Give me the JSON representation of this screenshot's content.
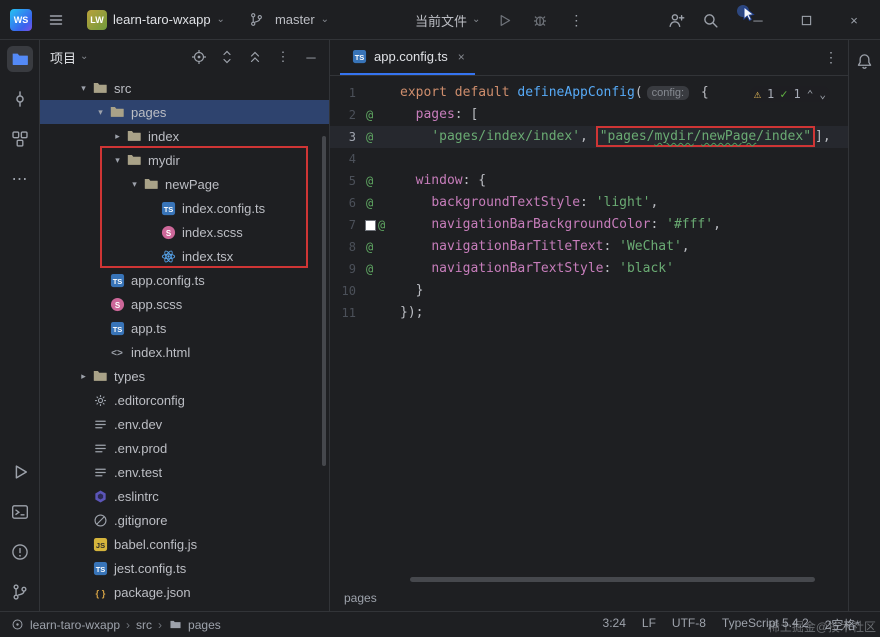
{
  "titlebar": {
    "logo": "WS",
    "project_avatar": "LW",
    "project_name": "learn-taro-wxapp",
    "branch": "master",
    "run_config": "当前文件"
  },
  "project_panel": {
    "title": "项目"
  },
  "tree": {
    "items": [
      {
        "label": "src",
        "type": "folder",
        "level": 1,
        "chev": "open"
      },
      {
        "label": "pages",
        "type": "folder",
        "level": 2,
        "chev": "open",
        "sel": 1
      },
      {
        "label": "index",
        "type": "folder",
        "level": 3,
        "chev": "closed"
      },
      {
        "label": "mydir",
        "type": "folder",
        "level": 3,
        "chev": "open"
      },
      {
        "label": "newPage",
        "type": "folder",
        "level": 4,
        "chev": "open"
      },
      {
        "label": "index.config.ts",
        "type": "ts",
        "level": 5
      },
      {
        "label": "index.scss",
        "type": "scss",
        "level": 5
      },
      {
        "label": "index.tsx",
        "type": "tsx",
        "level": 5
      },
      {
        "label": "app.config.ts",
        "type": "ts",
        "level": 2
      },
      {
        "label": "app.scss",
        "type": "scss",
        "level": 2
      },
      {
        "label": "app.ts",
        "type": "ts",
        "level": 2
      },
      {
        "label": "index.html",
        "type": "html",
        "level": 2
      },
      {
        "label": "types",
        "type": "folder",
        "level": 1,
        "chev": "closed"
      },
      {
        "label": ".editorconfig",
        "type": "gear",
        "level": 1
      },
      {
        "label": ".env.dev",
        "type": "env",
        "level": 1
      },
      {
        "label": ".env.prod",
        "type": "env",
        "level": 1
      },
      {
        "label": ".env.test",
        "type": "env",
        "level": 1
      },
      {
        "label": ".eslintrc",
        "type": "eslint",
        "level": 1
      },
      {
        "label": ".gitignore",
        "type": "git",
        "level": 1
      },
      {
        "label": "babel.config.js",
        "type": "js",
        "level": 1
      },
      {
        "label": "jest.config.ts",
        "type": "ts",
        "level": 1
      },
      {
        "label": "package.json",
        "type": "json",
        "level": 1
      }
    ]
  },
  "editor": {
    "tab": "app.config.ts",
    "inspections": {
      "warnings": "1",
      "passed": "1"
    },
    "breadcrumb": "pages",
    "lines": [
      {
        "n": "1",
        "g": "",
        "a": 0,
        "t": [
          {
            "c": "kw",
            "t": "export"
          },
          {
            "c": "pun",
            "t": " "
          },
          {
            "c": "kw",
            "t": "default"
          },
          {
            "c": "pun",
            "t": " "
          },
          {
            "c": "fn",
            "t": "defineAppConfig"
          },
          {
            "c": "pun",
            "t": "("
          },
          {
            "c": "inlay",
            "t": "config:"
          },
          {
            "c": "pun",
            "t": " {"
          }
        ]
      },
      {
        "n": "2",
        "g": "at",
        "a": 0,
        "t": [
          {
            "c": "pun",
            "t": "  "
          },
          {
            "c": "prop",
            "t": "pages"
          },
          {
            "c": "pun",
            "t": ": ["
          }
        ]
      },
      {
        "n": "3",
        "g": "at",
        "a": 1,
        "t": [
          {
            "c": "pun",
            "t": "    "
          },
          {
            "c": "str",
            "t": "'pages/index/index'"
          },
          {
            "c": "pun",
            "t": ", "
          },
          {
            "c": "str",
            "t": "\"pages/",
            "b": 1
          },
          {
            "c": "str squig",
            "t": "mydir",
            "b": 1
          },
          {
            "c": "str",
            "t": "/",
            "b": 1
          },
          {
            "c": "str squig",
            "t": "newPage",
            "b": 1
          },
          {
            "c": "str",
            "t": "/index\"",
            "b": 1
          },
          {
            "c": "pun",
            "t": "],"
          }
        ]
      },
      {
        "n": "4",
        "g": "",
        "a": 0,
        "t": []
      },
      {
        "n": "5",
        "g": "at",
        "a": 0,
        "t": [
          {
            "c": "pun",
            "t": "  "
          },
          {
            "c": "prop",
            "t": "window"
          },
          {
            "c": "pun",
            "t": ": {"
          }
        ]
      },
      {
        "n": "6",
        "g": "at",
        "a": 0,
        "t": [
          {
            "c": "pun",
            "t": "    "
          },
          {
            "c": "prop",
            "t": "backgroundTextStyle"
          },
          {
            "c": "pun",
            "t": ": "
          },
          {
            "c": "str",
            "t": "'light'"
          },
          {
            "c": "pun",
            "t": ","
          }
        ]
      },
      {
        "n": "7",
        "g": "swatch at",
        "a": 0,
        "t": [
          {
            "c": "pun",
            "t": "    "
          },
          {
            "c": "prop",
            "t": "navigationBarBackgroundColor"
          },
          {
            "c": "pun",
            "t": ": "
          },
          {
            "c": "str",
            "t": "'#fff'"
          },
          {
            "c": "pun",
            "t": ","
          }
        ]
      },
      {
        "n": "8",
        "g": "at",
        "a": 0,
        "t": [
          {
            "c": "pun",
            "t": "    "
          },
          {
            "c": "prop",
            "t": "navigationBarTitleText"
          },
          {
            "c": "pun",
            "t": ": "
          },
          {
            "c": "str",
            "t": "'WeChat'"
          },
          {
            "c": "pun",
            "t": ","
          }
        ]
      },
      {
        "n": "9",
        "g": "at",
        "a": 0,
        "t": [
          {
            "c": "pun",
            "t": "    "
          },
          {
            "c": "prop",
            "t": "navigationBarTextStyle"
          },
          {
            "c": "pun",
            "t": ": "
          },
          {
            "c": "str",
            "t": "'black'"
          }
        ]
      },
      {
        "n": "10",
        "g": "",
        "a": 0,
        "t": [
          {
            "c": "pun",
            "t": "  }"
          }
        ]
      },
      {
        "n": "11",
        "g": "",
        "a": 0,
        "t": [
          {
            "c": "pun",
            "t": "});"
          }
        ]
      }
    ]
  },
  "statusbar": {
    "path": [
      "learn-taro-wxapp",
      "src",
      "pages"
    ],
    "segments": [
      "3:24",
      "LF",
      "UTF-8",
      "TypeScript 5.4.2",
      "2空格*"
    ],
    "watermark": "稀土掘金@技术社区"
  },
  "icons": {
    "chevron-down": "⌄",
    "more-vertical": "⋮",
    "more-horizontal": "⋯",
    "minimize": "─",
    "close": "×",
    "warning": "⚠",
    "check": "✓",
    "chevron-up-small": "⌃",
    "chevron-down-small": "⌄",
    "separator": "›",
    "tree-expanded": "▾",
    "tree-collapsed": "▸"
  },
  "colors": {
    "accent": "#3574f0",
    "selection": "#2e436e",
    "annotation_red": "#cf3535"
  }
}
